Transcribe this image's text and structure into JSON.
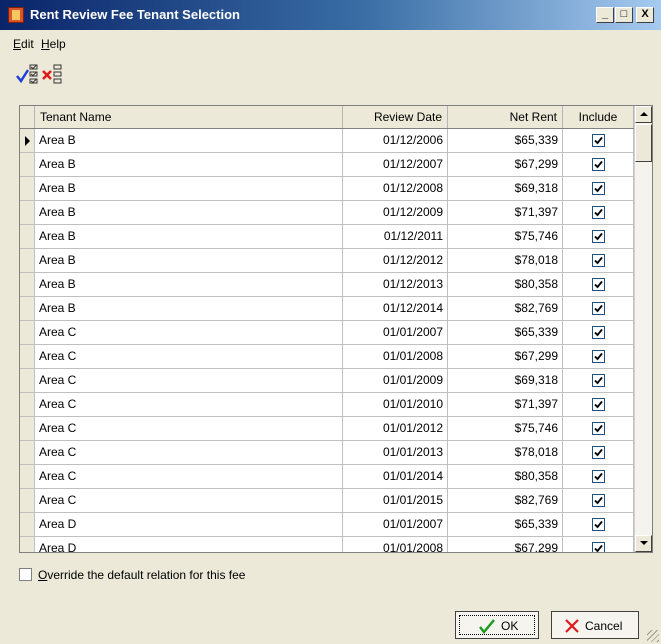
{
  "window": {
    "title": "Rent Review Fee Tenant Selection",
    "controls": {
      "minimize": "_",
      "maximize": "□",
      "close": "X"
    }
  },
  "menu": [
    {
      "label": "Edit",
      "accel": "E",
      "rest": "dit"
    },
    {
      "label": "Help",
      "accel": "H",
      "rest": "elp"
    }
  ],
  "toolbar": {
    "select_all_icon": "check-list-icon",
    "deselect_all_icon": "cross-list-icon"
  },
  "grid": {
    "columns": [
      "Tenant Name",
      "Review Date",
      "Net Rent",
      "Include"
    ],
    "rows": [
      {
        "name": "Area B",
        "date": "01/12/2006",
        "rent": "$65,339",
        "include": true
      },
      {
        "name": "Area B",
        "date": "01/12/2007",
        "rent": "$67,299",
        "include": true
      },
      {
        "name": "Area B",
        "date": "01/12/2008",
        "rent": "$69,318",
        "include": true
      },
      {
        "name": "Area B",
        "date": "01/12/2009",
        "rent": "$71,397",
        "include": true
      },
      {
        "name": "Area B",
        "date": "01/12/2011",
        "rent": "$75,746",
        "include": true
      },
      {
        "name": "Area B",
        "date": "01/12/2012",
        "rent": "$78,018",
        "include": true
      },
      {
        "name": "Area B",
        "date": "01/12/2013",
        "rent": "$80,358",
        "include": true
      },
      {
        "name": "Area B",
        "date": "01/12/2014",
        "rent": "$82,769",
        "include": true
      },
      {
        "name": "Area C",
        "date": "01/01/2007",
        "rent": "$65,339",
        "include": true
      },
      {
        "name": "Area C",
        "date": "01/01/2008",
        "rent": "$67,299",
        "include": true
      },
      {
        "name": "Area C",
        "date": "01/01/2009",
        "rent": "$69,318",
        "include": true
      },
      {
        "name": "Area C",
        "date": "01/01/2010",
        "rent": "$71,397",
        "include": true
      },
      {
        "name": "Area C",
        "date": "01/01/2012",
        "rent": "$75,746",
        "include": true
      },
      {
        "name": "Area C",
        "date": "01/01/2013",
        "rent": "$78,018",
        "include": true
      },
      {
        "name": "Area C",
        "date": "01/01/2014",
        "rent": "$80,358",
        "include": true
      },
      {
        "name": "Area C",
        "date": "01/01/2015",
        "rent": "$82,769",
        "include": true
      },
      {
        "name": "Area D",
        "date": "01/01/2007",
        "rent": "$65,339",
        "include": true
      },
      {
        "name": "Area D",
        "date": "01/01/2008",
        "rent": "$67,299",
        "include": true
      }
    ]
  },
  "override": {
    "accel": "O",
    "rest": "verride the default relation for this fee",
    "checked": false
  },
  "buttons": {
    "ok": {
      "label": "OK",
      "icon": "green-check-icon"
    },
    "cancel": {
      "label": "Cancel",
      "icon": "red-x-icon"
    }
  },
  "colors": {
    "titlebar": "#0a246a",
    "accent_check": "#1f3fd6",
    "accent_cross": "#e01a1a",
    "ok_check": "#1e9c1e"
  }
}
